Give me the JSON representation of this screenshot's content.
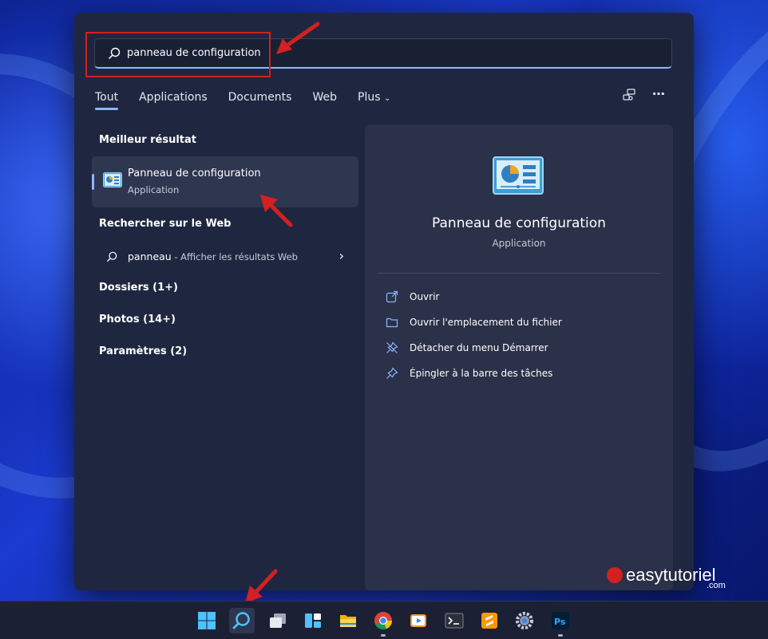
{
  "search": {
    "query_bold": "panneau",
    "query_rest": " de configuration"
  },
  "tabs": [
    {
      "label": "Tout",
      "active": true
    },
    {
      "label": "Applications"
    },
    {
      "label": "Documents"
    },
    {
      "label": "Web"
    },
    {
      "label": "Plus"
    }
  ],
  "more_icon": "more-dots-icon",
  "sections": {
    "best_result": "Meilleur résultat",
    "web_search": "Rechercher sur le Web",
    "folders": "Dossiers (1+)",
    "photos": "Photos (14+)",
    "settings": "Paramètres (2)"
  },
  "best_item": {
    "title_bold": "Panneau",
    "title_rest": " de configuration",
    "subtitle": "Application"
  },
  "web_item": {
    "term": "panneau",
    "desc": " - Afficher les résultats Web"
  },
  "detail": {
    "title": "Panneau de configuration",
    "subtitle": "Application",
    "actions": [
      {
        "label": "Ouvrir",
        "icon": "open-external-icon"
      },
      {
        "label": "Ouvrir l'emplacement du fichier",
        "icon": "folder-icon"
      },
      {
        "label": "Détacher du menu Démarrer",
        "icon": "unpin-icon"
      },
      {
        "label": "Épingler à la barre des tâches",
        "icon": "pin-icon"
      }
    ]
  },
  "watermark": {
    "brand": "easytutoriel",
    "tld": ".com"
  },
  "taskbar": [
    "start-icon",
    "search-icon",
    "task-view-icon",
    "widgets-icon",
    "file-explorer-icon",
    "chrome-icon",
    "media-player-icon",
    "terminal-icon",
    "sublime-icon",
    "settings-icon",
    "photoshop-icon"
  ],
  "colors": {
    "accent": "#8fb4ff",
    "panel": "#1f2740",
    "annotation": "#d42020"
  }
}
